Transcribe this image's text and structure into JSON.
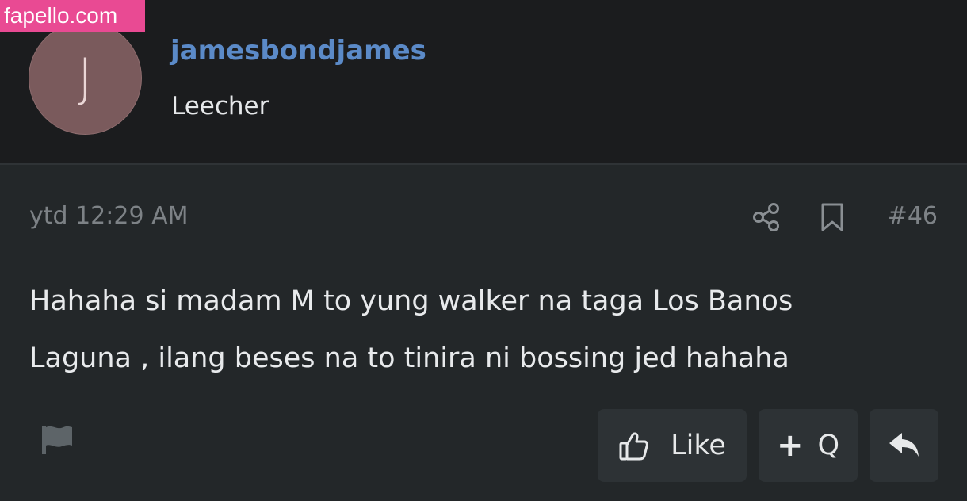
{
  "watermark": "fapello.com",
  "user": {
    "avatar_letter": "J",
    "name": "jamesbondjames",
    "title": "Leecher"
  },
  "post": {
    "timestamp": "ytd 12:29 AM",
    "number": "#46",
    "message_lines": [
      "Hahaha si madam M to yung walker na taga Los Banos",
      "Laguna , ilang beses na to tinira ni bossing jed hahaha"
    ]
  },
  "actions": {
    "like_label": "Like",
    "quote_plus": "+",
    "quote_label": "Q"
  },
  "icons": {
    "share": "share-icon",
    "bookmark": "bookmark-icon",
    "report": "flag-icon",
    "like": "thumbs-up-icon",
    "reply": "reply-icon"
  },
  "colors": {
    "username": "#5b8ac8",
    "watermark_bg": "#e94a93",
    "avatar_bg": "#7a5a5c",
    "header_bg": "#1b1c1e",
    "post_bg": "#232729",
    "button_bg": "#2d3235",
    "muted_text": "#7d8286"
  }
}
